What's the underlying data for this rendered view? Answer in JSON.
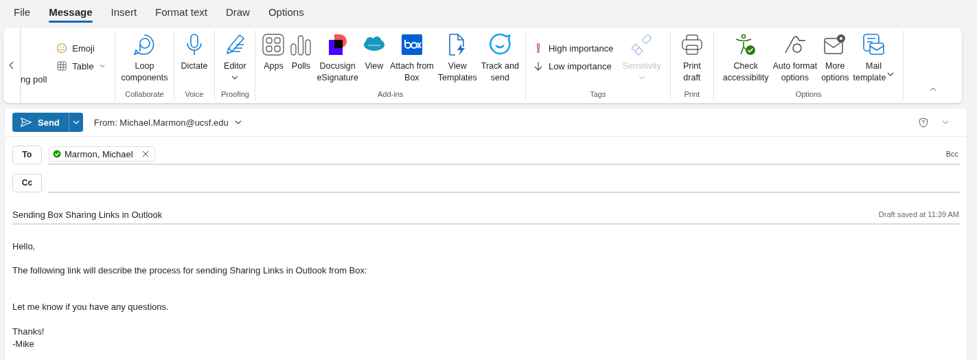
{
  "tabs": [
    {
      "label": "File",
      "selected": false
    },
    {
      "label": "Message",
      "selected": true
    },
    {
      "label": "Insert",
      "selected": false
    },
    {
      "label": "Format text",
      "selected": false
    },
    {
      "label": "Draw",
      "selected": false
    },
    {
      "label": "Options",
      "selected": false
    }
  ],
  "ribbon": {
    "groups": [
      {
        "items": [
          {
            "kind": "cut",
            "label": "ng poll"
          },
          {
            "kind": "small",
            "label": "Emoji",
            "dropdown": false
          },
          {
            "kind": "small",
            "label": "Table",
            "dropdown": true
          }
        ]
      },
      {
        "label": "Collaborate",
        "items": [
          {
            "kind": "large",
            "label": "Loop\ncomponents",
            "dropdown": false
          }
        ]
      },
      {
        "label": "Voice",
        "items": [
          {
            "kind": "large",
            "label": "Dictate",
            "dropdown": false
          }
        ]
      },
      {
        "label": "Proofing",
        "items": [
          {
            "kind": "large",
            "label": "Editor",
            "dropdown": true
          }
        ]
      },
      {
        "label": "Add-ins",
        "items": [
          {
            "kind": "large",
            "label": "Apps",
            "dropdown": false
          },
          {
            "kind": "large",
            "label": "Polls",
            "dropdown": false
          },
          {
            "kind": "large",
            "label": "Docusign\neSignature",
            "dropdown": false
          },
          {
            "kind": "large",
            "label": "View",
            "dropdown": false
          },
          {
            "kind": "large",
            "label": "Attach from\nBox",
            "dropdown": false
          },
          {
            "kind": "large",
            "label": "View\nTemplates",
            "dropdown": false
          },
          {
            "kind": "large",
            "label": "Track and\nsend",
            "dropdown": false
          }
        ]
      },
      {
        "label": "Tags",
        "items": [
          {
            "kind": "small",
            "label": "High importance",
            "dropdown": false,
            "disabled": false
          },
          {
            "kind": "small",
            "label": "Low importance",
            "dropdown": false,
            "disabled": false
          },
          {
            "kind": "large",
            "label": "Sensitivity",
            "dropdown": true,
            "disabled": true
          }
        ]
      },
      {
        "label": "Print",
        "items": [
          {
            "kind": "large",
            "label": "Print\ndraft",
            "dropdown": false
          }
        ]
      },
      {
        "label": "Options",
        "items": [
          {
            "kind": "large",
            "label": "Check\naccessibility",
            "dropdown": false
          },
          {
            "kind": "large",
            "label": "Auto format\noptions",
            "dropdown": false
          },
          {
            "kind": "large",
            "label": "More\noptions",
            "dropdown": false
          },
          {
            "kind": "large",
            "label": "Mail\ntemplate",
            "dropdown": true,
            "inline_caret": true
          }
        ]
      }
    ]
  },
  "compose": {
    "send_label": "Send",
    "from": "From: Michael.Marmon@ucsf.edu",
    "to_label": "To",
    "recipients": [
      {
        "name": "Marmon, Michael",
        "verified": true
      }
    ],
    "bcc_label": "Bcc",
    "cc_label": "Cc",
    "subject": "Sending Box Sharing Links in Outlook",
    "draft_status": "Draft saved at 11:39 AM",
    "body": [
      {
        "kind": "text",
        "text": "Hello,"
      },
      {
        "kind": "blank"
      },
      {
        "kind": "text",
        "text": "The following link will describe the process for sending Sharing Links in Outlook from Box:"
      },
      {
        "kind": "blank"
      },
      {
        "kind": "blank"
      },
      {
        "kind": "text",
        "text": "Let me know if you have any questions."
      },
      {
        "kind": "blank"
      },
      {
        "kind": "text",
        "text": "Thanks!"
      },
      {
        "kind": "text",
        "text": "-Mike"
      }
    ]
  }
}
